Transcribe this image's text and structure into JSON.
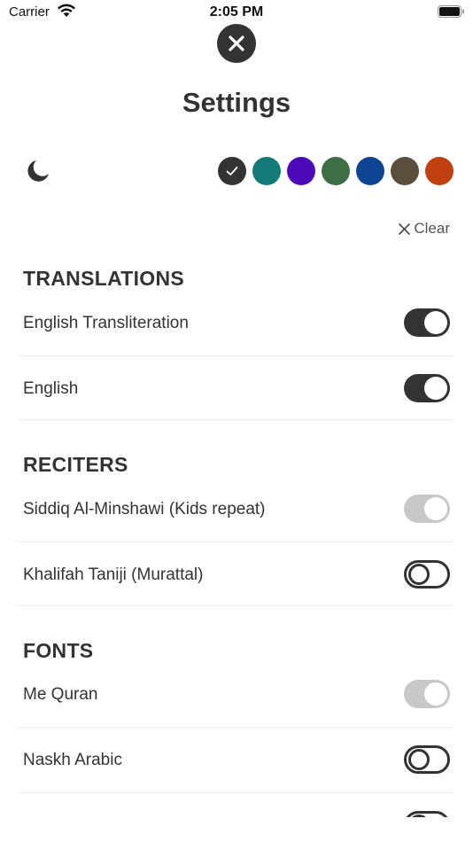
{
  "status_bar": {
    "carrier": "Carrier",
    "time": "2:05 PM"
  },
  "header": {
    "title": "Settings"
  },
  "theme": {
    "swatches": [
      {
        "color": "#333333",
        "selected": true
      },
      {
        "color": "#137a78",
        "selected": false
      },
      {
        "color": "#4e0ab8",
        "selected": false
      },
      {
        "color": "#3e6e44",
        "selected": false
      },
      {
        "color": "#0d4593",
        "selected": false
      },
      {
        "color": "#5c4e3d",
        "selected": false
      },
      {
        "color": "#c0400f",
        "selected": false
      }
    ]
  },
  "clear_label": "Clear",
  "sections": {
    "translations": {
      "title": "TRANSLATIONS",
      "items": [
        {
          "label": "English Transliteration",
          "state": "on"
        },
        {
          "label": "English",
          "state": "on"
        }
      ]
    },
    "reciters": {
      "title": "RECITERS",
      "items": [
        {
          "label": "Siddiq Al-Minshawi (Kids repeat)",
          "state": "disabled"
        },
        {
          "label": "Khalifah Taniji (Murattal)",
          "state": "off"
        }
      ]
    },
    "fonts": {
      "title": "FONTS",
      "items": [
        {
          "label": "Me Quran",
          "state": "disabled"
        },
        {
          "label": "Naskh Arabic",
          "state": "off"
        },
        {
          "label": "",
          "state": "off"
        }
      ]
    }
  },
  "icons": {
    "close": "close-icon",
    "moon": "moon-icon",
    "check": "check-icon",
    "clear": "x-icon",
    "wifi": "wifi-icon",
    "battery": "battery-icon"
  }
}
